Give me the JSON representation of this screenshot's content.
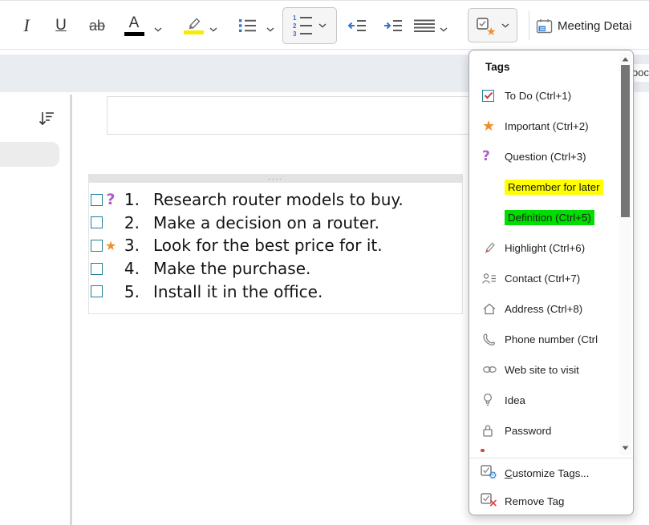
{
  "toolbar": {
    "italic_glyph": "I",
    "underline_glyph": "U",
    "strikethrough_glyph": "ab",
    "font_color_glyph": "A",
    "numbered_list_digits": [
      "1",
      "2",
      "3"
    ],
    "meeting_details_label": "Meeting Detai"
  },
  "header": {
    "tab_fragment": "ooc"
  },
  "tags_menu": {
    "title": "Tags",
    "items": [
      {
        "label": "To Do (Ctrl+1)"
      },
      {
        "label": "Important (Ctrl+2)"
      },
      {
        "label": "Question (Ctrl+3)"
      },
      {
        "label": "Remember for later",
        "highlight": "#ffff00"
      },
      {
        "label": "Definition (Ctrl+5)",
        "highlight": "#00dd00"
      },
      {
        "label": "Highlight (Ctrl+6)"
      },
      {
        "label": "Contact (Ctrl+7)"
      },
      {
        "label": "Address (Ctrl+8)"
      },
      {
        "label": "Phone number (Ctrl"
      },
      {
        "label": "Web site to visit"
      },
      {
        "label": "Idea"
      },
      {
        "label": "Password"
      }
    ],
    "customize": {
      "accel": "C",
      "rest": "ustomize Tags..."
    },
    "remove": {
      "pre": "Remove Ta",
      "accel": "g"
    }
  },
  "note": {
    "handle_dots": "....",
    "items": [
      {
        "number": "1.",
        "tag_glyph": "?",
        "text": "Research router models to buy."
      },
      {
        "number": "2.",
        "tag_glyph": "",
        "text": "Make a decision on a router."
      },
      {
        "number": "3.",
        "tag_glyph": "★",
        "text": "Look for the best price for it."
      },
      {
        "number": "4.",
        "tag_glyph": "",
        "text": "Make the purchase."
      },
      {
        "number": "5.",
        "tag_glyph": "",
        "text": "Install it in the office."
      }
    ]
  },
  "icons": {
    "star_glyph": "★",
    "question_glyph": "?",
    "gear_glyph": "⚙",
    "x_glyph": "×"
  },
  "colors": {
    "teal_checkbox": "#1e7f9c",
    "todo_check_red": "#c43e3e",
    "important_orange": "#ee8f2e",
    "question_purple": "#a95fc4",
    "yellow_highlight": "#ffff00",
    "green_highlight": "#00dd00",
    "accent_blue": "#3575c9",
    "band_gray_blue": "#e9edf2"
  }
}
